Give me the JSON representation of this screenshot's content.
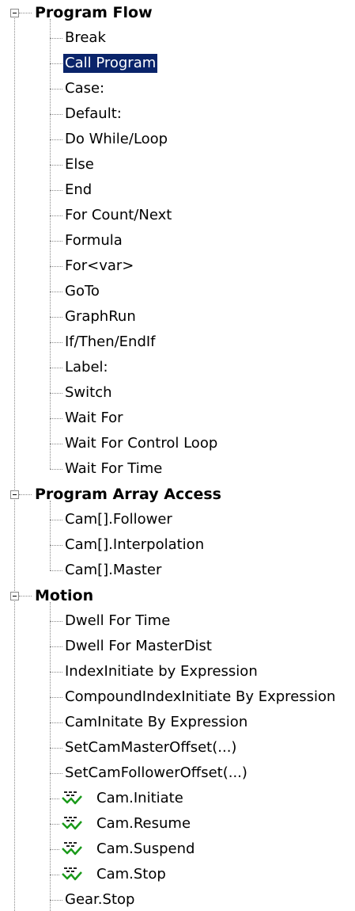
{
  "tree": {
    "program_flow": {
      "label": "Program Flow",
      "items": [
        "Break",
        "Call Program",
        "Case:",
        "Default:",
        "Do While/Loop",
        "Else",
        "End",
        "For Count/Next",
        "Formula",
        "For<var>",
        "GoTo",
        "GraphRun",
        "If/Then/EndIf",
        "Label:",
        "Switch",
        "Wait For",
        "Wait For Control Loop",
        "Wait For Time"
      ],
      "selected_item": "Call Program"
    },
    "program_array_access": {
      "label": "Program Array Access",
      "items": [
        "Cam[].Follower",
        "Cam[].Interpolation",
        "Cam[].Master"
      ]
    },
    "motion": {
      "label": "Motion",
      "items": [
        "Dwell For Time",
        "Dwell For MasterDist",
        "IndexInitiate by Expression",
        "CompoundIndexInitiate By Expression",
        "CamInitate By Expression",
        "SetCamMasterOffset(...)",
        "SetCamFollowerOffset(...)",
        "Cam.Initiate",
        "Cam.Resume",
        "Cam.Suspend",
        "Cam.Stop",
        "Gear.Stop"
      ],
      "icon_items": [
        "Cam.Initiate",
        "Cam.Resume",
        "Cam.Suspend",
        "Cam.Stop"
      ],
      "icon": "cam-motion-icon"
    }
  },
  "colors": {
    "selection_bg": "#0a246a",
    "selection_fg": "#ffffff",
    "connector": "#8a8a8a",
    "icon_green": "#1a9a1a"
  }
}
